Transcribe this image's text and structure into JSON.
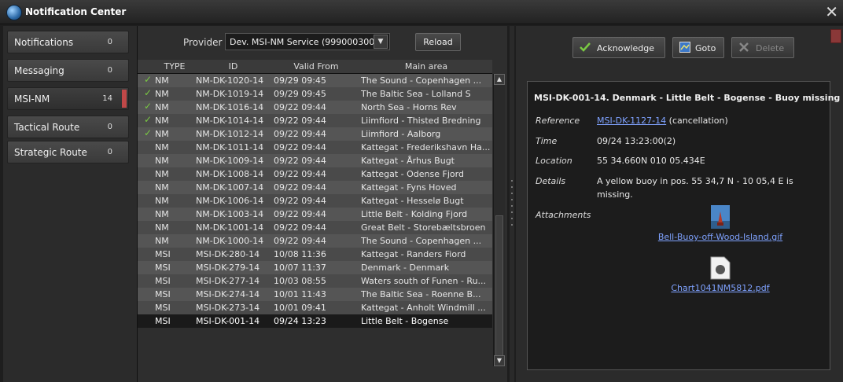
{
  "window": {
    "title": "Notification Center",
    "close_glyph": "✕"
  },
  "nav": [
    {
      "label": "Notifications",
      "count": "0",
      "selected": false
    },
    {
      "label": "Messaging",
      "count": "0",
      "selected": false
    },
    {
      "label": "MSI-NM",
      "count": "14",
      "selected": true
    },
    {
      "label": "Tactical Route",
      "count": "0",
      "selected": false
    },
    {
      "label": "Strategic Route",
      "count": "0",
      "selected": false
    }
  ],
  "provider": {
    "label": "Provider",
    "value": "Dev. MSI-NM Service (999000300)",
    "reload_label": "Reload"
  },
  "table": {
    "headers": [
      "TYPE",
      "ID",
      "Valid From",
      "Main area"
    ],
    "rows": [
      {
        "ack": true,
        "type": "NM",
        "id": "NM-DK-1020-14",
        "valid": "09/29 09:45",
        "area": "The Sound - Copenhagen ...",
        "bg": "#555555"
      },
      {
        "ack": true,
        "type": "NM",
        "id": "NM-DK-1019-14",
        "valid": "09/29 09:45",
        "area": "The Baltic Sea - Lolland S",
        "bg": "#4a4a4a"
      },
      {
        "ack": true,
        "type": "NM",
        "id": "NM-DK-1016-14",
        "valid": "09/22 09:44",
        "area": "North Sea - Horns Rev",
        "bg": "#555555"
      },
      {
        "ack": true,
        "type": "NM",
        "id": "NM-DK-1014-14",
        "valid": "09/22 09:44",
        "area": "Liimfiord - Thisted Bredning",
        "bg": "#4a4a4a"
      },
      {
        "ack": true,
        "type": "NM",
        "id": "NM-DK-1012-14",
        "valid": "09/22 09:44",
        "area": "Liimfiord - Aalborg",
        "bg": "#555555"
      },
      {
        "ack": false,
        "type": "NM",
        "id": "NM-DK-1011-14",
        "valid": "09/22 09:44",
        "area": "Kattegat - Frederikshavn Ha...",
        "bg": "#4a4a4a"
      },
      {
        "ack": false,
        "type": "NM",
        "id": "NM-DK-1009-14",
        "valid": "09/22 09:44",
        "area": "Kattegat - Århus Bugt",
        "bg": "#555555"
      },
      {
        "ack": false,
        "type": "NM",
        "id": "NM-DK-1008-14",
        "valid": "09/22 09:44",
        "area": "Kattegat - Odense Fjord",
        "bg": "#4a4a4a"
      },
      {
        "ack": false,
        "type": "NM",
        "id": "NM-DK-1007-14",
        "valid": "09/22 09:44",
        "area": "Kattegat - Fyns Hoved",
        "bg": "#555555"
      },
      {
        "ack": false,
        "type": "NM",
        "id": "NM-DK-1006-14",
        "valid": "09/22 09:44",
        "area": "Kattegat - Hesselø Bugt",
        "bg": "#4a4a4a"
      },
      {
        "ack": false,
        "type": "NM",
        "id": "NM-DK-1003-14",
        "valid": "09/22 09:44",
        "area": "Little Belt - Kolding Fjord",
        "bg": "#555555"
      },
      {
        "ack": false,
        "type": "NM",
        "id": "NM-DK-1001-14",
        "valid": "09/22 09:44",
        "area": "Great Belt - Storebæltsbroen",
        "bg": "#4a4a4a"
      },
      {
        "ack": false,
        "type": "NM",
        "id": "NM-DK-1000-14",
        "valid": "09/22 09:44",
        "area": "The Sound - Copenhagen ...",
        "bg": "#555555"
      },
      {
        "ack": false,
        "type": "MSI",
        "id": "MSI-DK-280-14",
        "valid": "10/08 11:36",
        "area": "Kattegat - Randers Fiord",
        "bg": "#4a4a4a"
      },
      {
        "ack": false,
        "type": "MSI",
        "id": "MSI-DK-279-14",
        "valid": "10/07 11:37",
        "area": "Denmark - Denmark",
        "bg": "#555555"
      },
      {
        "ack": false,
        "type": "MSI",
        "id": "MSI-DK-277-14",
        "valid": "10/03 08:55",
        "area": "Waters south of Funen - Ru...",
        "bg": "#4a4a4a"
      },
      {
        "ack": false,
        "type": "MSI",
        "id": "MSI-DK-274-14",
        "valid": "10/01 11:43",
        "area": "The Baltic Sea - Roenne B...",
        "bg": "#555555"
      },
      {
        "ack": false,
        "type": "MSI",
        "id": "MSI-DK-273-14",
        "valid": "10/01 09:41",
        "area": "Kattegat - Anholt Windmill ...",
        "bg": "#4a4a4a"
      },
      {
        "ack": false,
        "type": "MSI",
        "id": "MSI-DK-001-14",
        "valid": "09/24 13:23",
        "area": "Little Belt - Bogense",
        "bg": "#1a1a1a",
        "selected": true
      }
    ]
  },
  "actions": {
    "acknowledge": "Acknowledge",
    "goto": "Goto",
    "delete": "Delete"
  },
  "detail": {
    "title": "MSI-DK-001-14. Denmark - Little Belt - Bogense - Buoy missing",
    "reference_label": "Reference",
    "reference_link": "MSI-DK-1127-14",
    "reference_suffix": "(cancellation)",
    "time_label": "Time",
    "time_value": "09/24 13:23:00(2)",
    "location_label": "Location",
    "location_value": "55 34.660N 010 05.434E",
    "details_label": "Details",
    "details_line1": "A yellow buoy in pos. 55 34,7 N - 10 05,4 E is",
    "details_line2": "missing.",
    "attachments_label": "Attachments",
    "attachments": [
      "Bell-Buoy-off-Wood-Island.gif",
      "Chart1041NM5812.pdf"
    ]
  },
  "colors": {
    "accent_check": "#7ac943",
    "link": "#7fa2ff",
    "badge": "#c04848"
  }
}
